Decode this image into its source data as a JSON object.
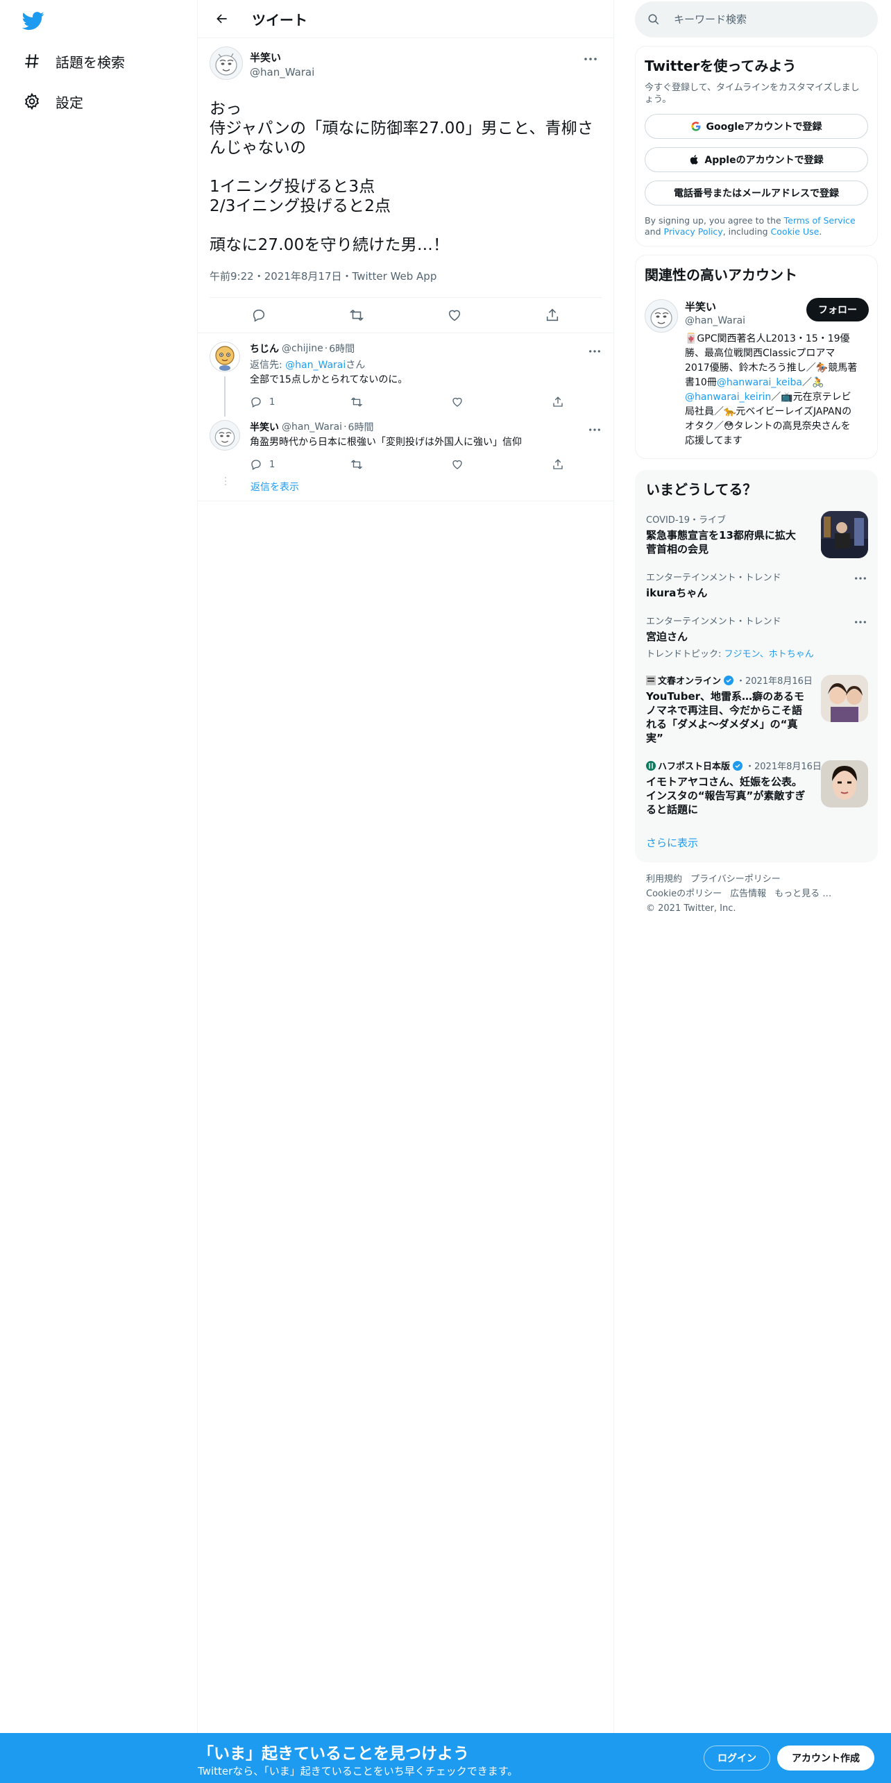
{
  "nav": {
    "logo": "twitter-bird-logo",
    "items": [
      {
        "label": "話題を検索",
        "icon": "hashtag-icon"
      },
      {
        "label": "設定",
        "icon": "gear-icon"
      }
    ]
  },
  "header": {
    "title": "ツイート"
  },
  "tweet": {
    "name": "半笑い",
    "handle": "@han_Warai",
    "text": "おっ\n侍ジャパンの「頑なに防御率27.00」男こと、青柳さんじゃないの\n\n1イニング投げると3点\n2/3イニング投げると2点\n\n頑なに27.00を守り続けた男…！",
    "time": "午前9:22",
    "date": "2021年8月17日",
    "source": "Twitter Web App"
  },
  "replies": [
    {
      "name": "ちじん",
      "handle": "@chijine",
      "time": "6時間",
      "reply_to_prefix": "返信先: ",
      "reply_to_handle": "@han_Warai",
      "reply_to_suffix": "さん",
      "text": "全部で15点しかとられてないのに。",
      "reply_count": "1"
    },
    {
      "name": "半笑い",
      "handle": "@han_Warai",
      "time": "6時間",
      "text": "角盈男時代から日本に根強い「変則投げは外国人に強い」信仰",
      "reply_count": "1"
    }
  ],
  "show_replies": "返信を表示",
  "search": {
    "placeholder": "キーワード検索"
  },
  "signup_card": {
    "title": "Twitterを使ってみよう",
    "desc": "今すぐ登録して、タイムラインをカスタマイズしましょう。",
    "google": "Googleアカウントで登録",
    "apple": "Appleのアカウントで登録",
    "phone": "電話番号またはメールアドレスで登録",
    "legal_1": "By signing up, you agree to the ",
    "terms": "Terms of Service",
    "legal_2": " and ",
    "privacy": "Privacy Policy",
    "legal_3": ", including ",
    "cookie": "Cookie Use",
    "legal_4": "."
  },
  "related": {
    "title": "関連性の高いアカウント",
    "name": "半笑い",
    "handle": "@han_Warai",
    "follow": "フォロー",
    "bio_1": "🀄GPC関西著名人L2013・15・19優勝、最高位戦関西Classicプロアマ2017優勝、鈴木たろう推し／🏇競馬著書10冊",
    "bio_link1": "@hanwarai_keiba",
    "bio_2": "／🚴",
    "bio_link2": "@hanwarai_keirin",
    "bio_3": "／📺元在京テレビ局社員／🐆元ベイビーレイズJAPANのオタク／😳タレントの高見奈央さんを応援してます"
  },
  "trends": {
    "title": "いまどうしてる？",
    "items": [
      {
        "context": "COVID-19・ライブ",
        "title": "緊急事態宣言を13都府県に拡大 菅首相の会見"
      },
      {
        "context": "エンターテインメント・トレンド",
        "title": "ikuraちゃん"
      },
      {
        "context": "エンターテインメント・トレンド",
        "title": "宮迫さん",
        "sub_prefix": "トレンドトピック: ",
        "sub_links": "フジモン、ホトちゃん"
      },
      {
        "source": "文春オンライン",
        "date": "・2021年8月16日",
        "title": "YouTuber、地雷系…癖のあるモノマネで再注目、今だからこそ語れる「ダメよ〜ダメダメ」の“真実”"
      },
      {
        "source": "ハフポスト日本版",
        "date": "・2021年8月16日",
        "title": "イモトアヤコさん、妊娠を公表。インスタの“報告写真”が素敵すぎると話題に"
      }
    ],
    "show_more": "さらに表示"
  },
  "footer": {
    "links": [
      "利用規約",
      "プライバシーポリシー",
      "Cookieのポリシー",
      "広告情報",
      "もっと見る …"
    ],
    "copyright": "© 2021 Twitter, Inc."
  },
  "bottom_bar": {
    "title": "「いま」起きていることを見つけよう",
    "sub": "Twitterなら、「いま」起きていることをいち早くチェックできます。",
    "login": "ログイン",
    "signup": "アカウント作成"
  },
  "colors": {
    "accent": "#1d9bf0",
    "text": "#0f1419",
    "muted": "#536471"
  }
}
